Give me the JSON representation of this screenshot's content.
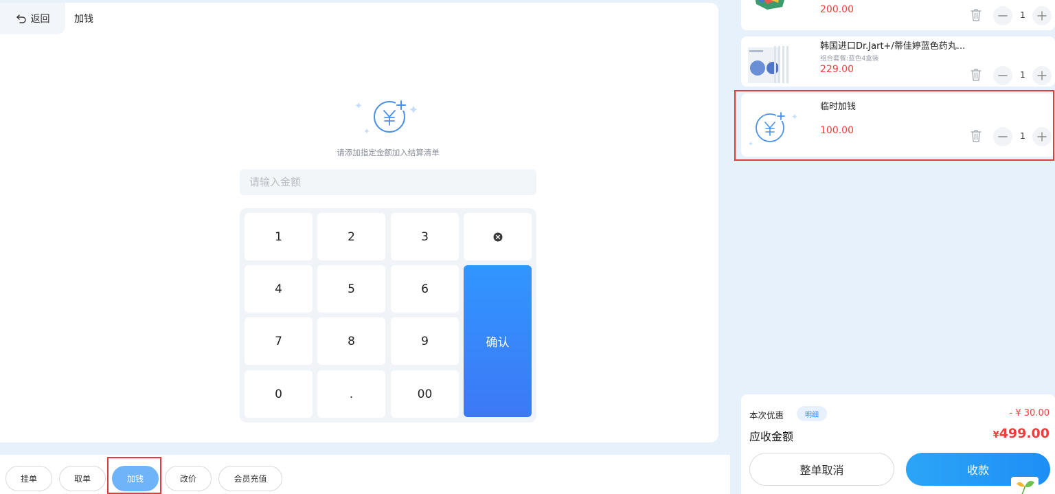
{
  "header": {
    "back_label": "返回",
    "title": "加钱"
  },
  "add_money": {
    "hint": "请添加指定金额加入结算清单",
    "amount_placeholder": "请输入金额",
    "keys": [
      "1",
      "2",
      "3",
      "4",
      "5",
      "6",
      "7",
      "8",
      "9",
      "0",
      ".",
      "00"
    ],
    "confirm_label": "确认"
  },
  "toolbar": {
    "buttons": [
      {
        "label": "挂单"
      },
      {
        "label": "取单"
      },
      {
        "label": "加钱",
        "active": true
      },
      {
        "label": "改价"
      },
      {
        "label": "会员充值"
      }
    ]
  },
  "cart": {
    "items": [
      {
        "price": "200.00",
        "qty": "1"
      },
      {
        "name": "韩国进口Dr.Jart+/蒂佳婷蓝色药丸...",
        "spec": "组合套餐:蓝色4盒装",
        "price": "229.00",
        "qty": "1"
      },
      {
        "name": "临时加钱",
        "price": "100.00",
        "qty": "1"
      }
    ]
  },
  "summary": {
    "discount_label": "本次优惠",
    "detail_label": "明细",
    "discount_value": "- ¥ 30.00",
    "due_label": "应收金额",
    "due_currency": "¥",
    "due_value": "499.00",
    "cancel_label": "整单取消",
    "pay_label": "收款"
  },
  "colors": {
    "accent": "#3196ff",
    "price": "#f03c3c",
    "highlight_frame": "#e33b3b"
  }
}
